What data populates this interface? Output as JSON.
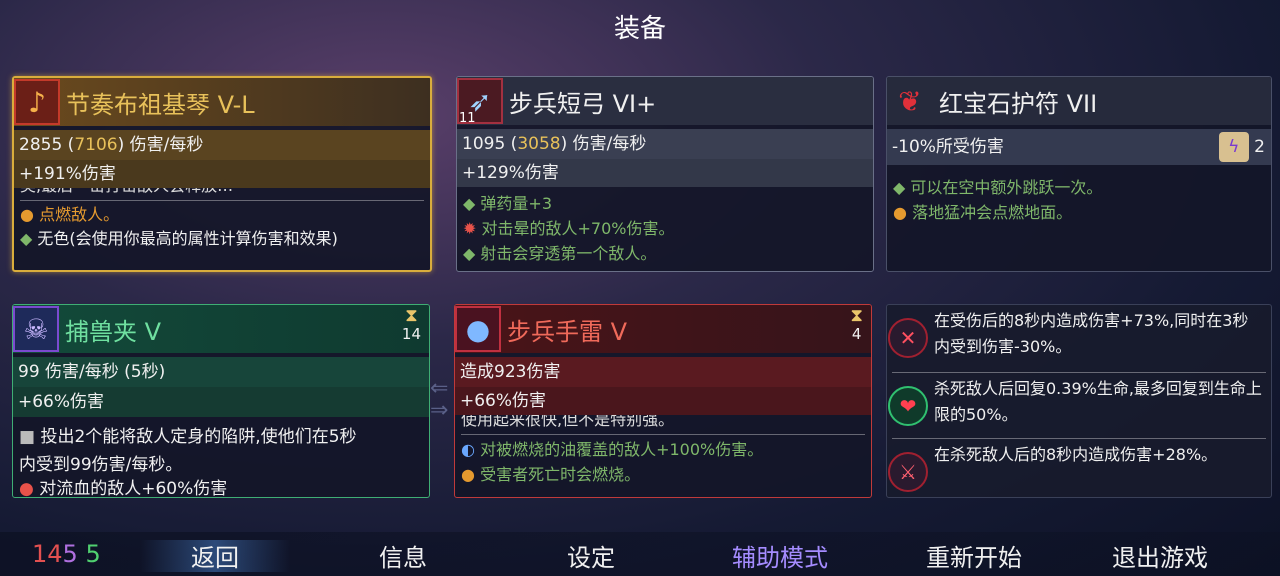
{
  "title": "装备",
  "cards": [
    {
      "name": "节奏布祖基琴 V-L",
      "dps_base": "2855",
      "dps_max": "7106",
      "dps_unit": "伤害/每秒",
      "damage": "+191%伤害",
      "cut_line": "美,最后一击打击敌人会释放…",
      "lines": [
        "点燃敌人。",
        "无色(会使用你最高的属性计算伤害和效果)"
      ]
    },
    {
      "name": "步兵短弓 VI+",
      "level": "11",
      "dps_base": "1095",
      "dps_max": "3058",
      "dps_unit": "伤害/每秒",
      "damage": "+129%伤害",
      "lines": [
        "弹药量+3",
        "对击晕的敌人+70%伤害。",
        "射击会穿透第一个敌人。"
      ]
    },
    {
      "name": "红宝石护符 VII",
      "stat": "-10%所受伤害",
      "scroll_count": "2",
      "lines": [
        "可以在空中额外跳跃一次。",
        "落地猛冲会点燃地面。"
      ]
    },
    {
      "name": "捕兽夹 V",
      "cooldown": "14",
      "dps": "99 伤害/每秒 (5秒)",
      "damage": "+66%伤害",
      "lines": [
        "投出2个能将敌人定身的陷阱,使他们在5秒",
        "内受到99伤害/每秒。",
        "对流血的敌人+60%伤害"
      ]
    },
    {
      "name": "步兵手雷 V",
      "cooldown": "4",
      "dps": "造成923伤害",
      "damage": "+66%伤害",
      "cut_line": "使用起来很快,但不是特别强。",
      "lines": [
        "对被燃烧的油覆盖的敌人+100%伤害。",
        "受害者死亡时会燃烧。"
      ]
    }
  ],
  "mutations": [
    {
      "text": "在受伤后的8秒内造成伤害+73%,同时在3秒内受到伤害-30%。",
      "icon": "rage-icon"
    },
    {
      "text": "杀死敌人后回复0.39%生命,最多回复到生命上限的50%。",
      "icon": "heal-icon"
    },
    {
      "text": "在杀死敌人后的8秒内造成伤害+28%。",
      "icon": "kill-icon"
    }
  ],
  "scrolls": {
    "brutality": "14",
    "tactics": "5",
    "survival": "5"
  },
  "nav": [
    "返回",
    "信息",
    "设定",
    "辅助模式",
    "重新开始",
    "退出游戏"
  ]
}
